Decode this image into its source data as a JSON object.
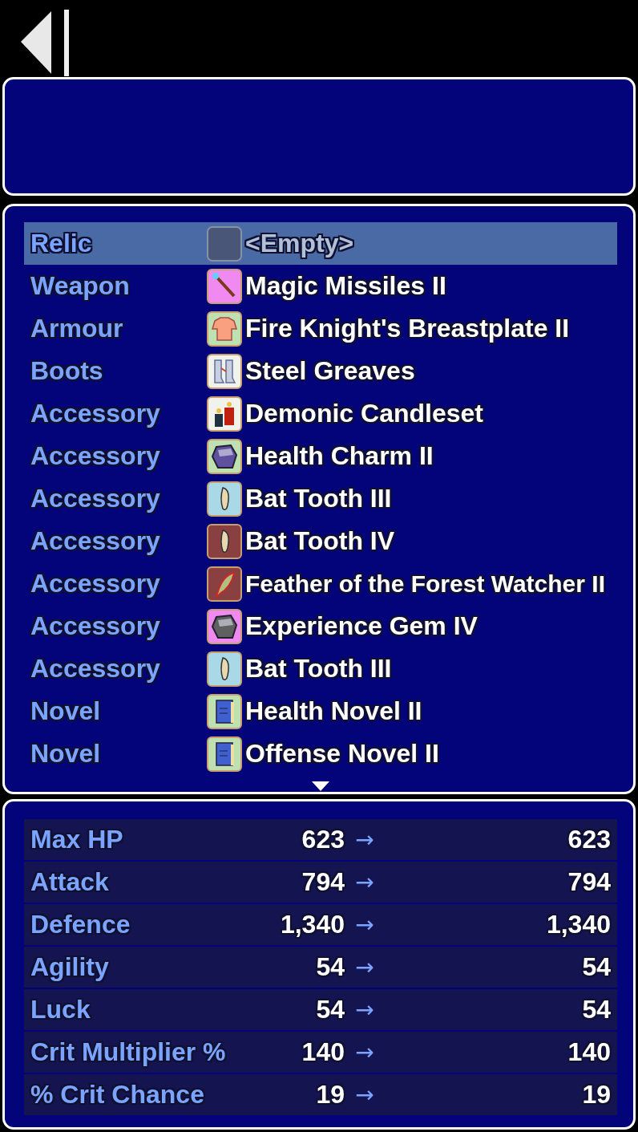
{
  "slots": [
    {
      "label": "Relic",
      "item": "<Empty>",
      "kind": "empty",
      "color": "#4a5678",
      "selected": true
    },
    {
      "label": "Weapon",
      "item": "Magic Missiles II",
      "kind": "staff",
      "color": "#f08af0",
      "selected": false
    },
    {
      "label": "Armour",
      "item": "Fire Knight's Breastplate II",
      "kind": "shirt",
      "color": "#bfe0b0",
      "selected": false
    },
    {
      "label": "Boots",
      "item": "Steel Greaves",
      "kind": "greaves",
      "color": "#f2f2ec",
      "selected": false
    },
    {
      "label": "Accessory",
      "item": "Demonic Candleset",
      "kind": "candles",
      "color": "#f2f2ec",
      "selected": false
    },
    {
      "label": "Accessory",
      "item": "Health Charm II",
      "kind": "gem",
      "color": "#bfe0b0",
      "selected": false
    },
    {
      "label": "Accessory",
      "item": "Bat Tooth III",
      "kind": "tooth",
      "color": "#a9d8e6",
      "selected": false
    },
    {
      "label": "Accessory",
      "item": "Bat Tooth IV",
      "kind": "tooth",
      "color": "#8a4040",
      "selected": false
    },
    {
      "label": "Accessory",
      "item": "Feather of the Forest Watcher II",
      "kind": "feather",
      "color": "#8a4040",
      "selected": false
    },
    {
      "label": "Accessory",
      "item": "Experience Gem IV",
      "kind": "gem",
      "color": "#f08af0",
      "selected": false
    },
    {
      "label": "Accessory",
      "item": "Bat Tooth III",
      "kind": "tooth",
      "color": "#a9d8e6",
      "selected": false
    },
    {
      "label": "Novel",
      "item": "Health Novel II",
      "kind": "book",
      "color": "#bfe0b0",
      "selected": false
    },
    {
      "label": "Novel",
      "item": "Offense Novel II",
      "kind": "book",
      "color": "#bfe0b0",
      "selected": false
    }
  ],
  "stats": [
    {
      "label": "Max HP",
      "current": "623",
      "arrow": "→",
      "new": "623"
    },
    {
      "label": "Attack",
      "current": "794",
      "arrow": "→",
      "new": "794"
    },
    {
      "label": "Defence",
      "current": "1,340",
      "arrow": "→",
      "new": "1,340"
    },
    {
      "label": "Agility",
      "current": "54",
      "arrow": "→",
      "new": "54"
    },
    {
      "label": "Luck",
      "current": "54",
      "arrow": "→",
      "new": "54"
    },
    {
      "label": "Crit Multiplier %",
      "current": "140",
      "arrow": "→",
      "new": "140"
    },
    {
      "label": "% Crit Chance",
      "current": "19",
      "arrow": "→",
      "new": "19"
    }
  ]
}
